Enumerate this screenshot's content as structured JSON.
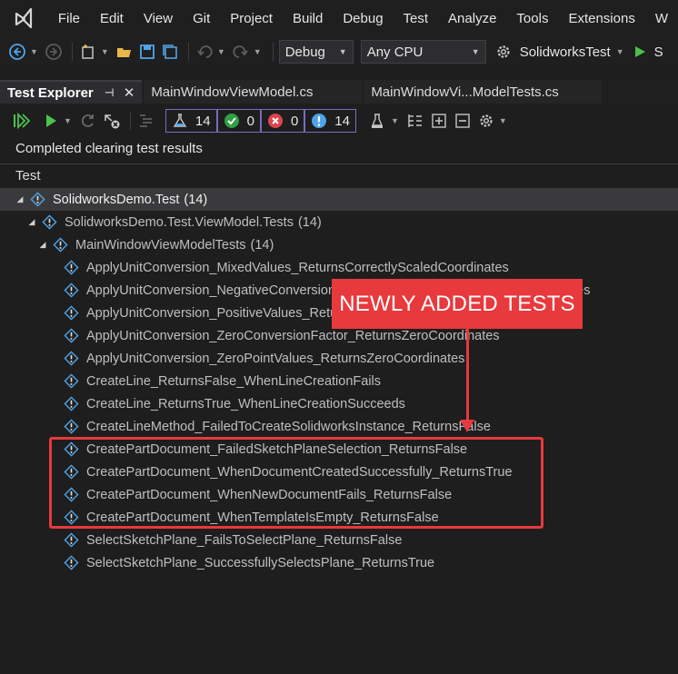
{
  "menubar": {
    "items": [
      "File",
      "Edit",
      "View",
      "Git",
      "Project",
      "Build",
      "Debug",
      "Test",
      "Analyze",
      "Tools",
      "Extensions",
      "W"
    ]
  },
  "toolbar": {
    "configuration": "Debug",
    "platform": "Any CPU",
    "startup_project": "SolidworksTest"
  },
  "tabs": {
    "test_explorer": "Test Explorer",
    "doc1": "MainWindowViewModel.cs",
    "doc2": "MainWindowVi...ModelTests.cs"
  },
  "test_toolbar": {
    "total_count": "14",
    "passed_count": "0",
    "failed_count": "0",
    "not_run_count": "14"
  },
  "status": "Completed clearing test results",
  "column_header": "Test",
  "tree": {
    "root": {
      "label": "SolidworksDemo.Test",
      "count": "(14)"
    },
    "namespace": {
      "label": "SolidworksDemo.Test.ViewModel.Tests",
      "count": "(14)"
    },
    "class": {
      "label": "MainWindowViewModelTests",
      "count": "(14)"
    },
    "tests": [
      "ApplyUnitConversion_MixedValues_ReturnsCorrectlyScaledCoordinates",
      "ApplyUnitConversion_NegativeConversionFactor_ReturnsCorrectlyScaledCoordinates",
      "ApplyUnitConversion_PositiveValues_ReturnsCorrectlyScaledCoordinates",
      "ApplyUnitConversion_ZeroConversionFactor_ReturnsZeroCoordinates",
      "ApplyUnitConversion_ZeroPointValues_ReturnsZeroCoordinates",
      "CreateLine_ReturnsFalse_WhenLineCreationFails",
      "CreateLine_ReturnsTrue_WhenLineCreationSucceeds",
      "CreateLineMethod_FailedToCreateSolidworksInstance_ReturnsFalse",
      "CreatePartDocument_FailedSketchPlaneSelection_ReturnsFalse",
      "CreatePartDocument_WhenDocumentCreatedSuccessfully_ReturnsTrue",
      "CreatePartDocument_WhenNewDocumentFails_ReturnsFalse",
      "CreatePartDocument_WhenTemplateIsEmpty_ReturnsFalse",
      "SelectSketchPlane_FailsToSelectPlane_ReturnsFalse",
      "SelectSketchPlane_SuccessfullySelectsPlane_ReturnsTrue"
    ]
  },
  "annotation": {
    "callout": "NEWLY ADDED TESTS",
    "color": "#e8393d"
  },
  "colors": {
    "info_icon": "#4fa3e8",
    "passed": "#2ea043",
    "failed": "#e0434b",
    "run_green": "#4cc24c"
  }
}
